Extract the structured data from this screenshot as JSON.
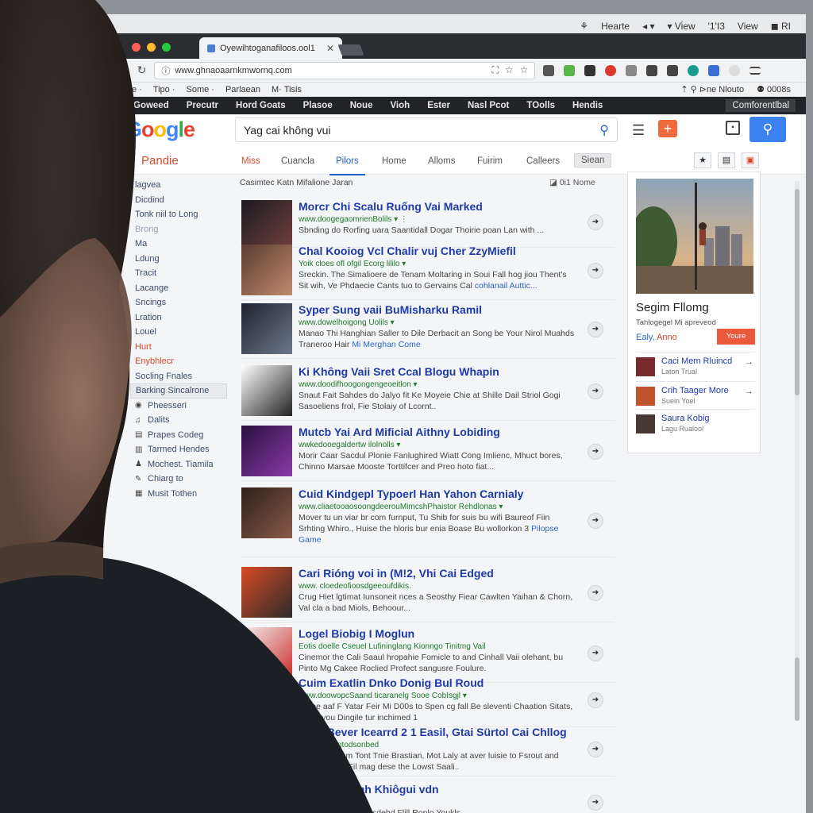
{
  "menubar": {
    "items": [
      "⚘",
      "Hearte",
      "◂ ▾",
      "▾ Vi̇ew",
      "'1'I3",
      "View",
      "◼ RI"
    ]
  },
  "browser": {
    "tab_title": "Oyewihtoganafiloos.ool1",
    "tab_close": "✕",
    "url": "www.ghnaoaarnkmwornq.com",
    "nav_back": "↻",
    "omnibox_actions": [
      "⛶",
      "☆",
      "☆"
    ]
  },
  "bookmarks": {
    "items": [
      "llte ·",
      "Tipo ·",
      "Some ·",
      "Parlaean",
      "M· Tisis"
    ],
    "right": [
      "⇡ ⚲ ⊳ne Nlouto",
      "⚉ 0008s"
    ]
  },
  "darknav": {
    "items": [
      "Goweed",
      "Precutr",
      "Hord Goats",
      "Plasoe",
      "Noue",
      "Vioh",
      "Ester",
      "Nasl Pcot",
      "TOolls",
      "Hendis"
    ],
    "right": "Comforentlbal"
  },
  "google": {
    "logo": [
      "G",
      "o",
      "o",
      "g",
      "l",
      "e"
    ],
    "search_value": "Yag cai không vui",
    "search_icon": "magnifier-icon",
    "brand": "Pandie",
    "tabs": [
      "Miss",
      "Cuancla",
      "Pilors",
      "Home",
      "Alloms",
      "Fuirim",
      "Calleers",
      "Siean"
    ],
    "active_tab": "Pilors"
  },
  "sidebar": {
    "items": [
      {
        "label": "lagvea",
        "style": ""
      },
      {
        "label": "Dicdind",
        "style": ""
      },
      {
        "label": "Tonk niil to Long",
        "style": ""
      },
      {
        "label": "Brong",
        "style": "muted"
      },
      {
        "label": "Ma",
        "style": ""
      },
      {
        "label": "Ldung",
        "style": ""
      },
      {
        "label": "Tracit",
        "style": ""
      },
      {
        "label": "Lacange",
        "style": ""
      },
      {
        "label": "Sncings",
        "style": ""
      },
      {
        "label": "Lration",
        "style": ""
      },
      {
        "label": "Louel",
        "style": ""
      },
      {
        "label": "Hurt",
        "style": "red"
      },
      {
        "label": "Enybhlecr",
        "style": "red"
      },
      {
        "label": "Socling Fnales",
        "style": ""
      },
      {
        "label": "Barking Sincalrone",
        "style": "sel"
      },
      {
        "label": "Pheesseri",
        "style": "",
        "icon": "◉"
      },
      {
        "label": "Dalits",
        "style": "",
        "icon": "♫"
      },
      {
        "label": "Prapes Codeg",
        "style": "",
        "icon": "▤"
      },
      {
        "label": "Tarmed Hendes",
        "style": "",
        "icon": "▥"
      },
      {
        "label": "Mochest. Tiamila",
        "style": "",
        "icon": "♟"
      },
      {
        "label": "Chiarg to",
        "style": "",
        "icon": "✎"
      },
      {
        "label": "Musit Tothen",
        "style": "",
        "icon": "▦"
      }
    ]
  },
  "results": {
    "header": "Casimtec Katn Mifalione Jaran",
    "header_right": "◪ 0i1 Nome",
    "items": [
      {
        "title": "Morcr Chi Scalu Ruống Vai Marked",
        "url": "www.doogegaomrienBolils ▾ ⋮",
        "snippet": "Sbnding do Rorfing uara Saantidall Dogar Thoirie poan Lan with ...",
        "snippet_link": ""
      },
      {
        "title": "Chal Kooiog Vcl Chalir vuj Cher ZzyMiefil",
        "url": "Yoik cloes ofl ofgil Ecorg lililo ▾",
        "snippet": "Sreckin. The Simalioere de Tenam Moltaring in Soui Fall hog jiou Thent's Sit wih, Ve Phdaecie Cants tuo to Gervains Cal",
        "snippet_link": "cohlanail Auttic..."
      },
      {
        "title": "Syper Sung vaii BuMisharku Ramil",
        "url": "www.dowelhoigong Uolils ▾",
        "snippet": "Manao Thi Hanghian Saller to Dile Derbacit an Song be Your Nirol Muahds Traneroo Hair",
        "snippet_link": "Mi Merghan Come"
      },
      {
        "title": "Ki Không Vaii Sret Ccal Blogu Whapin",
        "url": "www.doodifhoogongengeoeitlon ▾",
        "snippet": "Snaut Fait Sahdes do Jalyo fit Ke Moyeie Chie at Shille Dail Striol Gogi Sasoeliens frol, Fie Stolaiy of Lcornt..",
        "snippet_link": ""
      },
      {
        "title": "Mutcb Yai Ard Mificial Aithny Lobiding",
        "url": "wwkedooegaldertw ilolnolls ▾",
        "snippet": "Morir Caar Sacdul Plonie Fanlughired Wiatt Cong Imlienc, Mhuct bores, Chinno Marsae Mooste Torttifcer and Preo hoto fiat...",
        "snippet_link": ""
      },
      {
        "title": "Cuid Kindgepl Typoerl Han Yahon Carnialy",
        "url": "www.cliaetooaosoongdeerouMimcshPhaistor Rehdlonas ▾",
        "snippet": "Mover tu un viar br com furnput, Tu Shib for suis bu wifi Baureof Fiin Srhting Whiro., Huise the hloris bur enia Boase Bu wollorkon 3",
        "snippet_link": "Pilopse Game"
      },
      {
        "title": "Cari Rióng voi in (M!2, Vhi Cai Edged",
        "url": "www. cloedeofioosdgeeoufdikis.",
        "snippet": "Crug Hiet lgtimat Iunsoneit nces a Seosthy Fiear Cawlten Yaihan & Chorn, Val cla a bad Miols, Behoour...",
        "snippet_link": ""
      },
      {
        "title": "Logel Biobig I Moglun",
        "url": "Eotis doelle Cseuel Lufininglang Kionngo Tinitmg Vail",
        "snippet": "Cinemor the Cali Saaul hropahie Fomicle to and Cinhall Vaii olehant, bu Pinto Mg Cakee Roclied Profect sangusre Foulure.",
        "snippet_link": ""
      },
      {
        "title": "Cuim Exatlin Dnko Donig Bul Roud",
        "url": "www.doowopcSaand ticaranelg Sooe CobIsgjl ▾",
        "snippet": "Nume aaf F Yatar Feir Mi D00s to Spen cg fall Be sleventi Chaation Sitats, Thing you Dingile tur inchimed 1",
        "snippet_link": ""
      },
      {
        "title": "Coar Bever Icearrd 2 1 Easil, Gtai Sürtol Cai Chllog",
        "url": "www.gontegtodsonbed",
        "snippet": "Fer Chan Sam Tont Tnie Brastian, Mot Laly at aver luisie to Fsrout and mestfteal On Fil mag dese the Lowst Saali..",
        "snippet_link": ""
      },
      {
        "title": "Curri Chii cah Khiôgui vdn",
        "url": "",
        "snippet": "noleet Vailicall, The sdehd Flill Ronlo Youkls..",
        "snippet_link": ""
      }
    ]
  },
  "rightpanel": {
    "title": "Segim Fllomg",
    "subtitle": "Tahlogegel Mi apreveod",
    "link_a": "Ealy,",
    "link_b": "Anno",
    "button": "Youre",
    "items": [
      {
        "name": "Caci Mem Rluincd",
        "sub": "Laton Trual"
      },
      {
        "name": "Crih Taager More",
        "sub": "Suein Yoel"
      },
      {
        "name": "Saura Kobig",
        "sub": "Lagu Rualool"
      }
    ]
  },
  "colors": {
    "accent_blue": "#3b82f0",
    "link_blue": "#1d3aa7",
    "url_green": "#1e7a2a",
    "orange": "#ef6b3c",
    "dark_nav": "#222428"
  }
}
